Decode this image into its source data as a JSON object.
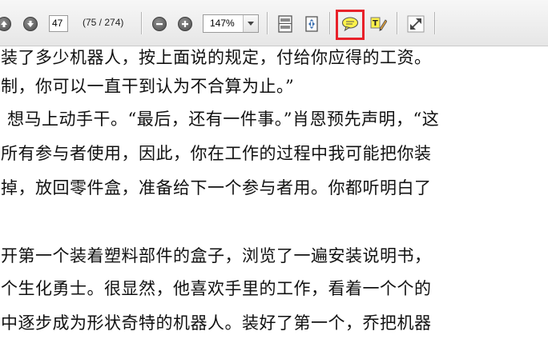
{
  "toolbar": {
    "page_number": "47",
    "page_count": "(75 / 274)",
    "zoom_level": "147%"
  },
  "document": {
    "lines": [
      "装了多少机器人，按上面说的规定，付给你应得的工资。",
      "制，你可以一直干到认为不合算为止。”",
      "想马上动手干。“最后，还有一件事。”肖恩预先声明，“这",
      "所有参与者使用，因此，你在工作的过程中我可能把你装",
      "掉，放回零件盒，准备给下一个参与者用。你都听明白了",
      "开第一个装着塑料部件的盒子，浏览了一遍安装说明书，",
      "个生化勇士。很显然，他喜欢手里的工作，看着一个个的",
      "中逐步成为形状奇特的机器人。装好了第一个，乔把机器"
    ]
  },
  "colors": {
    "highlight_border": "#e8212a",
    "comment_icon_fill": "#fff24a"
  }
}
